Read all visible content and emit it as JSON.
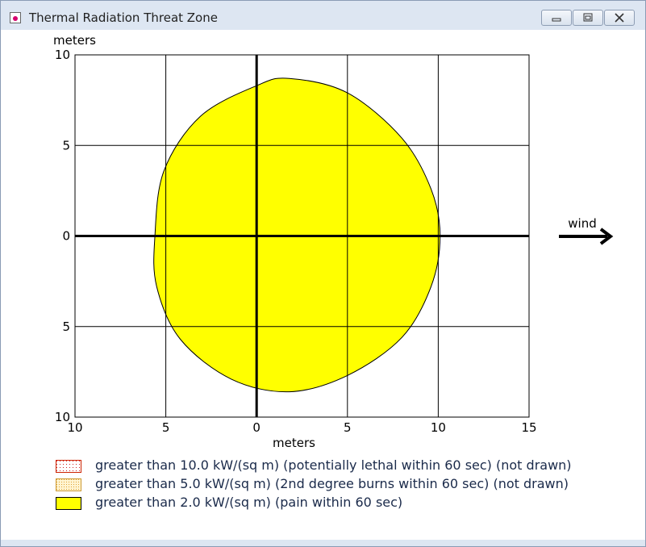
{
  "window": {
    "title": "Thermal Radiation Threat Zone",
    "buttons": [
      "minimize",
      "restore",
      "close"
    ]
  },
  "chart_data": {
    "type": "area",
    "xlabel": "meters",
    "ylabel": "meters",
    "xlim": [
      -10,
      15
    ],
    "ylim": [
      -10,
      10
    ],
    "x_ticks": [
      -10,
      -5,
      0,
      5,
      10,
      15
    ],
    "y_ticks": [
      -10,
      -5,
      0,
      5,
      10
    ],
    "x_tick_labels": [
      "10",
      "5",
      "0",
      "5",
      "10",
      "15"
    ],
    "y_tick_labels": [
      "10",
      "5",
      "0",
      "5",
      "10"
    ],
    "grid": true,
    "wind_label": "wind",
    "wind_direction": "right",
    "series": [
      {
        "name": "greater than 2.0 kW/(sq m) (pain within 60 sec)",
        "fill": "#ffff00",
        "boundary": [
          [
            1.8,
            8.7
          ],
          [
            5,
            7.9
          ],
          [
            8,
            5.4
          ],
          [
            9.6,
            2.6
          ],
          [
            10.1,
            0
          ],
          [
            9.6,
            -2.8
          ],
          [
            8,
            -5.6
          ],
          [
            5,
            -7.7
          ],
          [
            1.8,
            -8.6
          ],
          [
            -1.4,
            -7.9
          ],
          [
            -4.2,
            -5.7
          ],
          [
            -5.5,
            -2.8
          ],
          [
            -5.6,
            0
          ],
          [
            -5.1,
            3.6
          ],
          [
            -3.1,
            6.6
          ],
          [
            0,
            8.3
          ]
        ]
      }
    ]
  },
  "legend": [
    {
      "label": "greater than 10.0 kW/(sq m) (potentially lethal within 60 sec) (not drawn)",
      "color": "#ffdcdc",
      "pattern": "dots-red"
    },
    {
      "label": "greater than 5.0 kW/(sq m) (2nd degree burns within 60 sec) (not drawn)",
      "color": "#ffe8a8",
      "pattern": "dots-orange"
    },
    {
      "label": "greater than 2.0 kW/(sq m) (pain within 60 sec)",
      "color": "#ffff00",
      "pattern": "solid"
    }
  ]
}
